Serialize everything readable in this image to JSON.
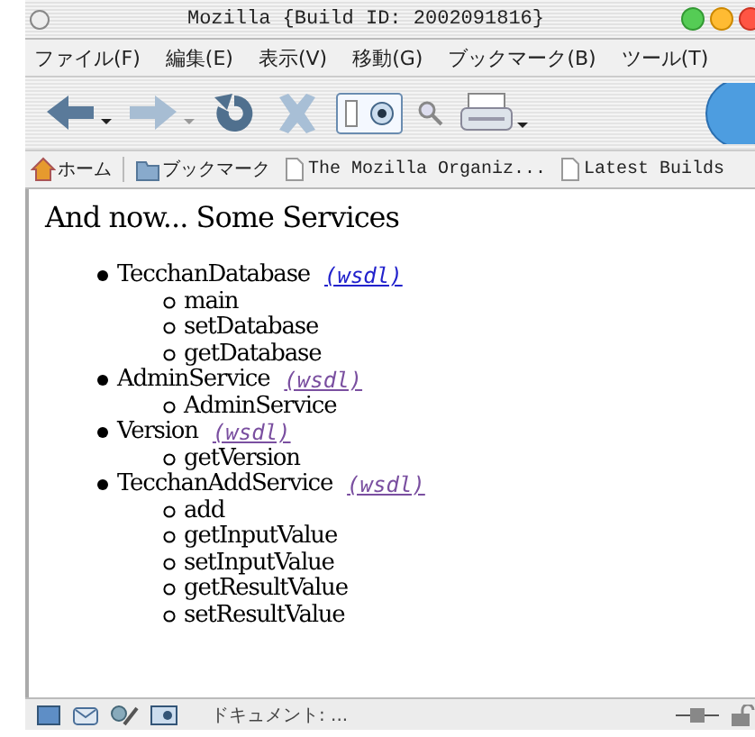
{
  "window": {
    "title": "Mozilla {Build ID: 2002091816}"
  },
  "menu": [
    "ファイル(F)",
    "編集(E)",
    "表示(V)",
    "移動(G)",
    "ブックマーク(B)",
    "ツール(T)"
  ],
  "personal_bar": [
    {
      "kind": "home",
      "label": "ホーム"
    },
    {
      "kind": "folder",
      "label": "ブックマーク"
    },
    {
      "kind": "page",
      "label": "The Mozilla Organiz..."
    },
    {
      "kind": "page",
      "label": "Latest Builds"
    }
  ],
  "heading": "And now... Some Services",
  "services": [
    {
      "name": "TecchanDatabase",
      "link": "(wsdl)",
      "visited": false,
      "methods": [
        "main",
        "setDatabase",
        "getDatabase"
      ]
    },
    {
      "name": "AdminService",
      "link": "(wsdl)",
      "visited": true,
      "methods": [
        "AdminService"
      ]
    },
    {
      "name": "Version",
      "link": "(wsdl)",
      "visited": true,
      "methods": [
        "getVersion"
      ]
    },
    {
      "name": "TecchanAddService",
      "link": "(wsdl)",
      "visited": true,
      "methods": [
        "add",
        "getInputValue",
        "setInputValue",
        "getResultValue",
        "setResultValue"
      ]
    }
  ],
  "status_bar": {
    "text": "ドキュメント: ..."
  }
}
